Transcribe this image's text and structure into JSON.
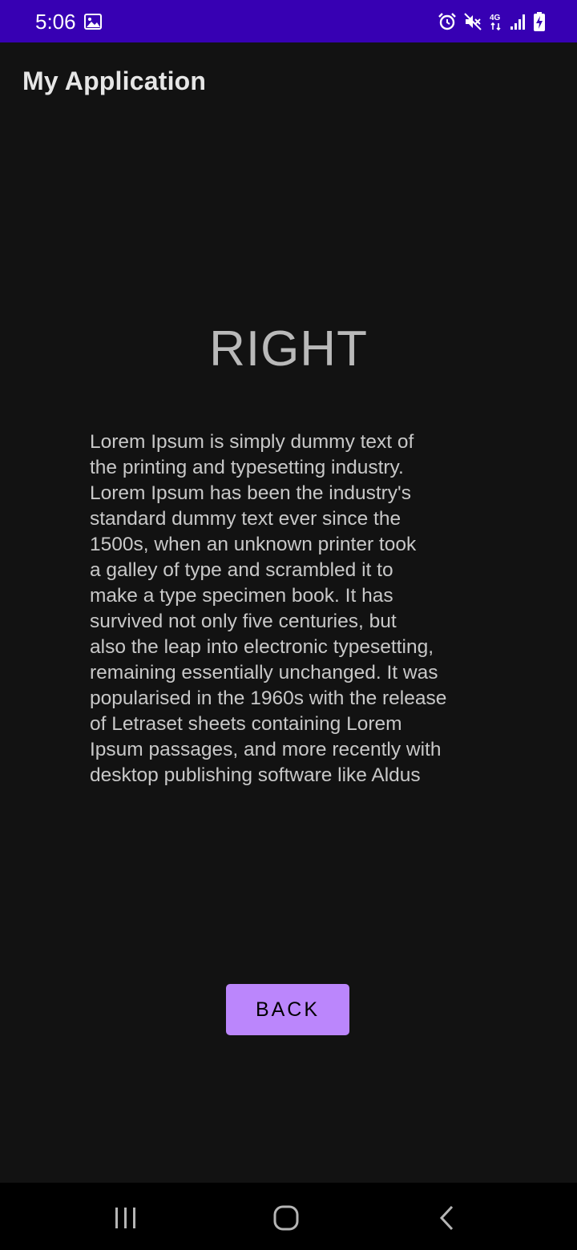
{
  "status_bar": {
    "time": "5:06",
    "network": "4G",
    "color": "#3700b3",
    "icons": [
      "gallery-icon",
      "alarm-icon",
      "mute-icon",
      "network-4g-icon",
      "signal-icon",
      "battery-charging-icon"
    ]
  },
  "app_bar": {
    "title": "My Application"
  },
  "content": {
    "heading": "RIGHT",
    "body": "Lorem Ipsum is simply dummy text of\nthe printing and typesetting industry.\nLorem Ipsum has been the industry's\nstandard dummy text ever since the\n1500s, when an unknown printer took\na galley of type and scrambled it to\nmake a type specimen book. It has\nsurvived not only five centuries, but\nalso the leap into electronic typesetting,\nremaining essentially unchanged. It was\npopularised in the 1960s with the release\nof Letraset sheets containing Lorem\nIpsum passages, and more recently with\ndesktop publishing software like Aldus",
    "back_label": "BACK",
    "button_color": "#bb86fc"
  },
  "nav_bar": {
    "icons": [
      "recents-icon",
      "home-icon",
      "back-icon"
    ]
  }
}
